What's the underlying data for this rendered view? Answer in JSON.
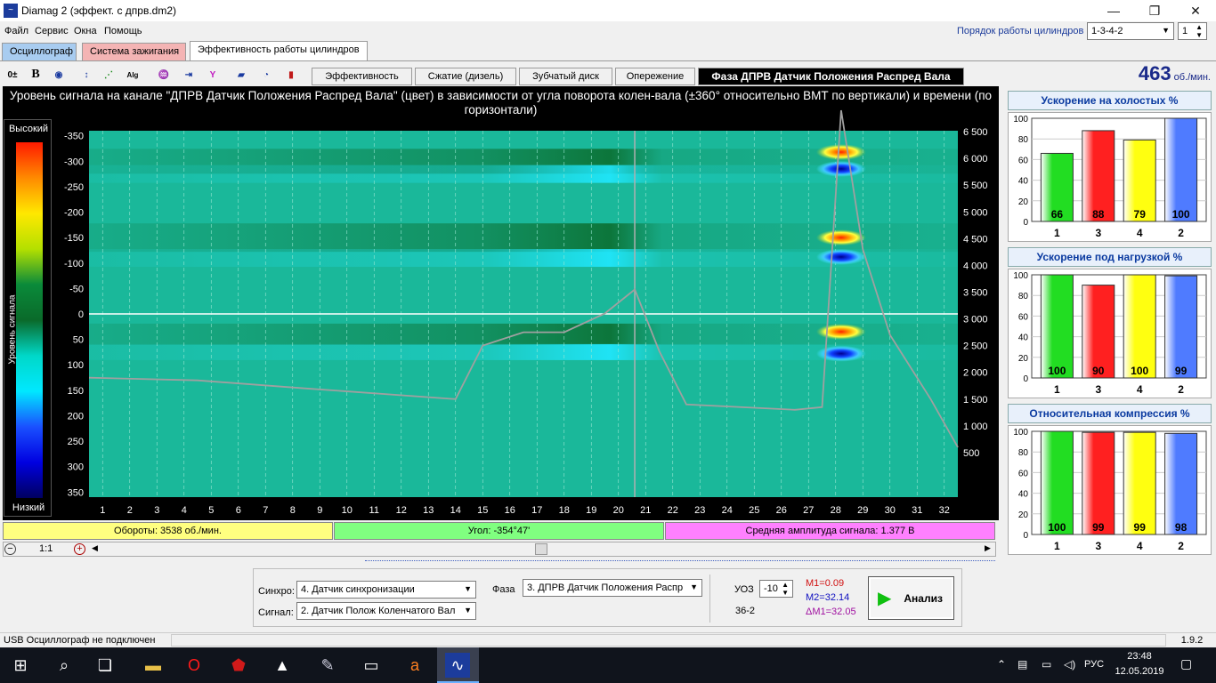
{
  "window": {
    "title": "Diamag 2 (эффект. с дпрв.dm2)",
    "minimize": "—",
    "maximize": "❐",
    "close": "✕"
  },
  "menu": [
    "Файл",
    "Сервис",
    "Окна",
    "Помощь"
  ],
  "firing": {
    "label": "Порядок работы цилиндров",
    "value": "1-3-4-2",
    "count": "1"
  },
  "tabs": [
    {
      "label": "Осциллограф",
      "color": "#a8ccf0"
    },
    {
      "label": "Система зажигания",
      "color": "#f4b4b4"
    },
    {
      "label": "Эффективность работы цилиндров",
      "color": "#ffffff"
    }
  ],
  "toolbar_icons": [
    "offset-icon",
    "bold-icon",
    "rpm-icon",
    "scale-icon",
    "line-icon",
    "alg-icon",
    "filter-icon",
    "numbers-icon",
    "marker-icon",
    "cars-icon",
    "gauge-icon",
    "report-icon"
  ],
  "subtabs": [
    "Эффективность",
    "Сжатие (дизель)",
    "Зубчатый диск",
    "Опережение",
    "Фаза ДПРВ Датчик Положения Распред Вала"
  ],
  "rpm": {
    "value": "463",
    "unit": "об./мин."
  },
  "plot": {
    "title": "Уровень сигнала на канале \"ДПРВ Датчик Положения Распред Вала\" (цвет) в зависимости от угла поворота колен-вала (±360° относительно ВМТ по вертикали) и времени (по горизонтали)",
    "colorbar": {
      "high": "Высокий",
      "low": "Низкий",
      "label": "Уровень сигнала"
    },
    "y_ticks": [
      "-350",
      "-300",
      "-250",
      "-200",
      "-150",
      "-100",
      "-50",
      "0",
      "50",
      "100",
      "150",
      "200",
      "250",
      "300",
      "350"
    ],
    "x_ticks": [
      "1",
      "2",
      "3",
      "4",
      "5",
      "6",
      "7",
      "8",
      "9",
      "10",
      "11",
      "12",
      "13",
      "14",
      "15",
      "16",
      "17",
      "18",
      "19",
      "20",
      "21",
      "22",
      "23",
      "24",
      "25",
      "26",
      "27",
      "28",
      "29",
      "30",
      "31",
      "32"
    ],
    "rpm_ticks": [
      "6 500",
      "6 000",
      "5 500",
      "5 000",
      "4 500",
      "4 000",
      "3 500",
      "3 000",
      "2 500",
      "2 000",
      "1 500",
      "1 000",
      "500"
    ]
  },
  "info": {
    "rpm": "Обороты:  3538 об./мин.",
    "angle": "Угол:  -354°47'",
    "amp": "Средняя амплитуда сигнала:  1.377 В"
  },
  "zoom": {
    "minus": "−",
    "ratio": "1:1",
    "plus": "+"
  },
  "panels": [
    {
      "title": "Ускорение на холостых %",
      "ticks": [
        "100",
        "80",
        "60",
        "40",
        "20",
        "0"
      ],
      "bars": [
        {
          "cyl": "1",
          "value": 66,
          "color": "#22dd22"
        },
        {
          "cyl": "3",
          "value": 88,
          "color": "#ff2020"
        },
        {
          "cyl": "4",
          "value": 79,
          "color": "#ffff10"
        },
        {
          "cyl": "2",
          "value": 100,
          "color": "#4f7bff"
        }
      ]
    },
    {
      "title": "Ускорение под нагрузкой %",
      "ticks": [
        "100",
        "80",
        "60",
        "40",
        "20",
        "0"
      ],
      "bars": [
        {
          "cyl": "1",
          "value": 100,
          "color": "#22dd22"
        },
        {
          "cyl": "3",
          "value": 90,
          "color": "#ff2020"
        },
        {
          "cyl": "4",
          "value": 100,
          "color": "#ffff10"
        },
        {
          "cyl": "2",
          "value": 99,
          "color": "#4f7bff"
        }
      ]
    },
    {
      "title": "Относительная компрессия %",
      "ticks": [
        "100",
        "80",
        "60",
        "40",
        "20",
        "0"
      ],
      "bars": [
        {
          "cyl": "1",
          "value": 100,
          "color": "#22dd22"
        },
        {
          "cyl": "3",
          "value": 99,
          "color": "#ff2020"
        },
        {
          "cyl": "4",
          "value": 99,
          "color": "#ffff10"
        },
        {
          "cyl": "2",
          "value": 98,
          "color": "#4f7bff"
        }
      ]
    }
  ],
  "controls": {
    "sync_label": "Синхро:",
    "sync_value": "4.  Датчик синхронизации",
    "signal_label": "Сигнал:",
    "signal_value": "2.  Датчик Полож Коленчатого Вал",
    "phase_label": "Фаза",
    "phase_value": "3.  ДПРВ Датчик Положения Распр",
    "uoz_label": "УОЗ",
    "uoz_value": "-10",
    "teeth": "36-2",
    "m1": "M1=0.09",
    "m2": "M2=32.14",
    "dm": "ΔM1=32.05",
    "analyze": "Анализ"
  },
  "status": {
    "left": "USB Осциллограф не подключен",
    "version": "1.9.2"
  },
  "taskbar": {
    "lang": "РУС",
    "time": "23:48",
    "date": "12.05.2019"
  }
}
